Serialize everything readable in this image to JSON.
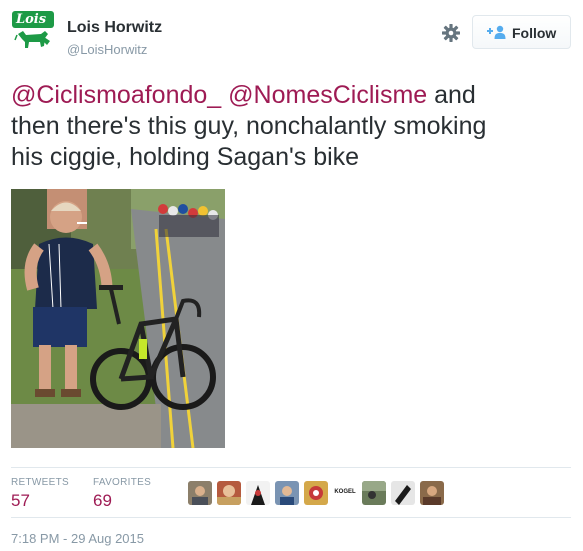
{
  "user": {
    "name": "Lois Horwitz",
    "handle": "@LoisHorwitz",
    "avatar_logo_text": "Lois"
  },
  "actions": {
    "follow_label": "Follow",
    "settings_icon": "gear-icon",
    "follow_icon": "add-user-icon"
  },
  "tweet": {
    "mention1": "@Ciclismoafondo_",
    "mention2": "@NomesCiclisme",
    "text_line1_rest": " and",
    "text_line2": "then there's this guy, nonchalantly smoking",
    "text_line3": "his ciggie, holding Sagan's bike"
  },
  "stats": {
    "retweets_label": "RETWEETS",
    "retweets_count": "57",
    "favorites_label": "FAVORITES",
    "favorites_count": "69"
  },
  "favoriters": {
    "kogel_text": "KOGEL"
  },
  "timestamp": "7:18 PM - 29 Aug 2015",
  "colors": {
    "mention": "#9e1b54",
    "secondary_text": "#8899a6",
    "brand_green": "#1d9a46",
    "follow_icon": "#55acee"
  }
}
